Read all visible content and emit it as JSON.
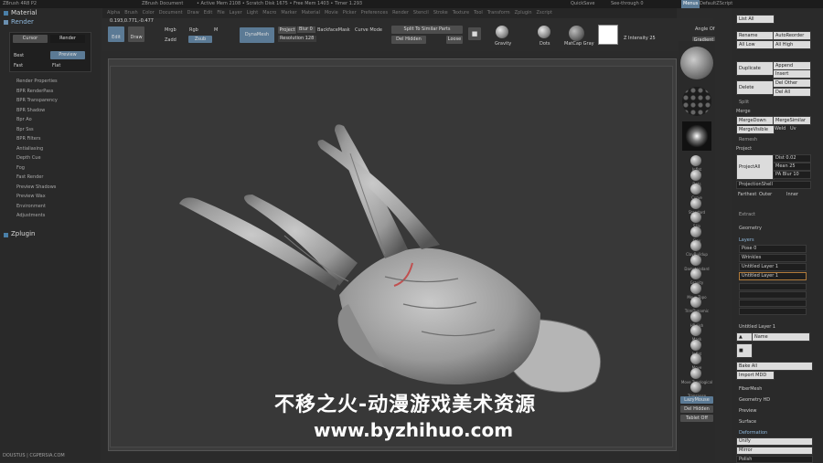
{
  "titlebar": {
    "app": "ZBrush 4R8 P2",
    "doc": "ZBrush Document",
    "stats": "• Active Mem 2108 • Scratch Disk 1675 • Free Mem 1403 • Timer 1.293",
    "quicksave": "QuickSave",
    "seethrough": "See-through 0",
    "menus": "Menus",
    "script": "DefaultZScript"
  },
  "menubar": [
    "Alpha",
    "Brush",
    "Color",
    "Document",
    "Draw",
    "Edit",
    "File",
    "Layer",
    "Light",
    "Macro",
    "Marker",
    "Material",
    "Movie",
    "Picker",
    "Preferences",
    "Render",
    "Stencil",
    "Stroke",
    "Texture",
    "Tool",
    "Transform",
    "Zplugin",
    "Zscript"
  ],
  "left_panel": {
    "material": "Material",
    "render": "Render",
    "cursor_btn": "Cursor",
    "render_btn": "Render",
    "best": "Best",
    "preview": "Preview",
    "fast": "Fast",
    "flat": "Flat",
    "items": [
      "Render Properties",
      "BPR RenderPass",
      "BPR Transparency",
      "BPR Shadow",
      "Bpr Ao",
      "Bpr Sss",
      "BPR Filters",
      "Antialiasing",
      "Depth Cue",
      "Fog",
      "Fast Render",
      "Preview Shadows",
      "Preview Wax",
      "Environment",
      "Adjustments"
    ],
    "zplugin": "Zplugin",
    "credit": "DOUSTUS | CGPERSIA.COM"
  },
  "coords": "0.193,0.771,-0.477",
  "toolbar": {
    "edit": "Edit",
    "draw": "Draw",
    "mrgb": "Mrgb",
    "rgb": "Rgb",
    "m": "M",
    "zadd": "Zadd",
    "zsub": "Zsub",
    "dynamesh": "DynaMesh",
    "project": "Project",
    "blur": "Blur 0",
    "resolution": "Resolution 128",
    "backface": "BackfaceMask",
    "curve_mode": "Curve Mode",
    "split_similar": "Split To Similar Parts",
    "del_hidden": "Del Hidden",
    "loose": "Loose",
    "gravity": "Gravity",
    "dots": "Dots",
    "matcap": "MatCap Gray",
    "angle": "Angle Of",
    "intensity": "Z Intensity 25",
    "gradient": "Gradient"
  },
  "shelf": [
    "Inflat",
    "Dots",
    "Curve",
    "Standard",
    "SUo",
    "Clay",
    "ClayBuildup",
    "Damstandard",
    "Gravity",
    "Move Topo",
    "TrimDynamic",
    "HPolish",
    "Mask",
    "Inflat",
    "Move",
    "Move Topological",
    "Transpose"
  ],
  "shelf_bottom": [
    "LazyMouse",
    "Del Hidden",
    "Tablet Off"
  ],
  "right_panel": {
    "list_all": "List All",
    "rename": "Rename",
    "autoreorder": "AutoReorder",
    "all_low": "All Low",
    "all_high": "All High",
    "duplicate": "Duplicate",
    "append": "Append",
    "insert": "Insert",
    "delete": "Delete",
    "del_other": "Del Other",
    "del_all": "Del All",
    "split": "Split",
    "merge": "Merge",
    "mergedown": "MergeDown",
    "mergesimilar": "MergeSimilar",
    "mergevisible": "MergeVisible",
    "weld": "Weld",
    "uv": "Uv",
    "remesh": "Remesh",
    "project_head": "Project",
    "projectall": "ProjectAll",
    "dist": "Dist 0.02",
    "mean": "Mean 25",
    "pa_blur": "PA Blur 10",
    "projectionshell": "ProjectionShell",
    "farthest": "Farthest",
    "outer": "Outer",
    "inner": "Inner",
    "extract": "Extract",
    "geometry": "Geometry",
    "layers": "Layers",
    "layer_items": [
      "Pose 0",
      "Wrinkles",
      "Untitled Layer 1",
      "Untitled Layer 1"
    ],
    "untitled": "Untitled Layer 1",
    "name": "Name",
    "bake_all": "Bake All",
    "import_mdd": "Import MDD",
    "fibermesh": "FiberMesh",
    "geometry_hd": "Geometry HD",
    "preview": "Preview",
    "surface": "Surface",
    "deformation": "Deformation",
    "unify": "Unify",
    "mirror": "Mirror",
    "polish": "Polish"
  },
  "watermark": {
    "line1": "不移之火-动漫游戏美术资源",
    "line2": "www.byzhihuo.com"
  },
  "colors": {
    "accent": "#5b7a95",
    "panel": "#2a2a2a",
    "viewport": "#383838",
    "model": "#a8a8a8"
  }
}
